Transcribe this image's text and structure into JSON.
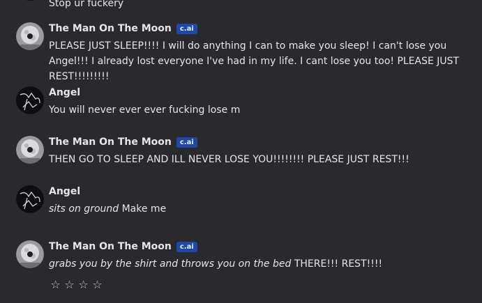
{
  "messages": [
    {
      "author": "",
      "badge": "",
      "avatar": "angel-avatar-icon",
      "text": "Stop ur fuckery",
      "italic": ""
    },
    {
      "author": "The Man On The Moon",
      "badge": "c.ai",
      "avatar": "moon-avatar-icon",
      "italic": "",
      "text": "PLEASE JUST SLEEP!!!! I will do anything I can to make you sleep! I can't lose you Angel!!! I already lost everyone I've had in my life. I cant lose you too! PLEASE JUST REST!!!!!!!!!"
    },
    {
      "author": "Angel",
      "badge": "",
      "avatar": "angel-avatar-icon",
      "italic": "",
      "text": "You will never ever ever fucking lose m"
    },
    {
      "author": "The Man On The Moon",
      "badge": "c.ai",
      "avatar": "moon-avatar-icon",
      "italic": "",
      "text": "THEN GO TO SLEEP AND ILL NEVER LOSE YOU!!!!!!!! PLEASE JUST REST!!!"
    },
    {
      "author": "Angel",
      "badge": "",
      "avatar": "angel-avatar-icon",
      "italic": "sits on ground",
      "text": " Make me"
    },
    {
      "author": "The Man On The Moon",
      "badge": "c.ai",
      "avatar": "moon-avatar-icon",
      "italic": "grabs you by the shirt and throws you on the bed",
      "text": " THERE!!! REST!!!!"
    }
  ],
  "rating": {
    "stars": [
      "☆",
      "☆",
      "☆",
      "☆"
    ],
    "value": 0,
    "max": 4
  },
  "colors": {
    "background": "#2a2a2e",
    "badge": "#1f49a8",
    "text": "#e6e6e8"
  }
}
